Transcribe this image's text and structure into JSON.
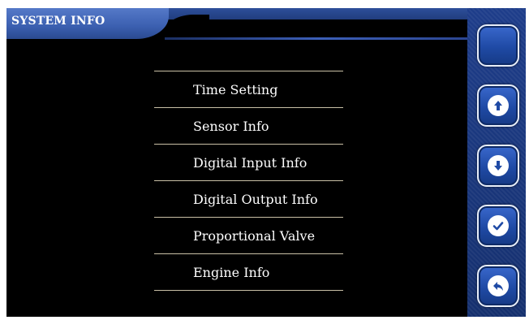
{
  "header": {
    "title": "SYSTEM INFO"
  },
  "menu": {
    "items": [
      {
        "label": "Time Setting"
      },
      {
        "label": "Sensor Info"
      },
      {
        "label": "Digital Input Info"
      },
      {
        "label": "Digital Output Info"
      },
      {
        "label": "Proportional Valve"
      },
      {
        "label": "Engine Info"
      }
    ]
  },
  "sidebar": {
    "buttons": [
      {
        "icon": "blank"
      },
      {
        "icon": "arrow-up-icon"
      },
      {
        "icon": "arrow-down-icon"
      },
      {
        "icon": "check-icon"
      },
      {
        "icon": "back-icon"
      }
    ]
  },
  "colors": {
    "background": "#000000",
    "accent_blue": "#2a52a8",
    "separator": "#c9c0a6",
    "text": "#ffffff"
  }
}
